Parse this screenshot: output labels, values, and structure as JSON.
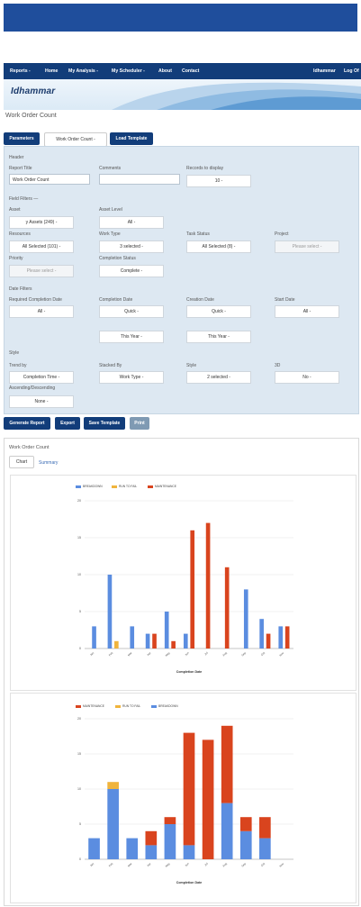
{
  "nav": {
    "items": [
      "Reports -",
      "Home",
      "My Analysis -",
      "My Scheduler -",
      "About",
      "Contact"
    ],
    "user": "ldhammar",
    "logout": "Log Of"
  },
  "brand": {
    "logo": "Idhammar"
  },
  "page_title": "Work Order Count",
  "tabs": {
    "parameters": "Parameters",
    "report": "Work Order Count -",
    "load": "Load Template"
  },
  "header_section": {
    "title": "Header",
    "report_title_label": "Report Title",
    "report_title_value": "Work Order Count",
    "comments_label": "Comments",
    "comments_value": "",
    "records_label": "Records to display",
    "records_value": "10 -"
  },
  "field_filters": {
    "title": "Field Filters —",
    "asset_label": "Asset",
    "asset_value": "y Assets (249) -",
    "asset_level_label": "Asset Level",
    "asset_level_value": "All -",
    "resources_label": "Resources",
    "resources_value": "All Selected (101) -",
    "work_type_label": "Work Type",
    "work_type_value": "3 selected -",
    "task_status_label": "Task Status",
    "task_status_value": "All Selected (8) -",
    "project_label": "Project",
    "project_value": "Please select -",
    "priority_label": "Priority",
    "priority_value": "Please select -",
    "completion_status_label": "Completion Status",
    "completion_status_value": "Complete -"
  },
  "date_filters": {
    "title": "Date Filters",
    "required_label": "Required Completion Date",
    "required_value": "All -",
    "completion_label": "Completion Date",
    "completion_value": "Quick -",
    "completion_range": "This Year -",
    "creation_label": "Creation Date",
    "creation_value": "Quick -",
    "creation_range": "This Year -",
    "start_label": "Start Date",
    "start_value": "All -"
  },
  "style_section": {
    "title": "Style",
    "trend_label": "Trend by",
    "trend_value": "Completion Time -",
    "stacked_label": "Stacked By",
    "stacked_value": "Work Type -",
    "style_label": "Style",
    "style_value": "2 selected -",
    "threed_label": "3D",
    "threed_value": "No -",
    "order_label": "Ascending/Descending",
    "order_value": "None -"
  },
  "actions": {
    "generate": "Generate Report",
    "export": "Export",
    "save": "Save Template",
    "print": "Print"
  },
  "report": {
    "title": "Work Order Count",
    "tab_chart": "Chart",
    "tab_summary": "Summary"
  },
  "colors": {
    "breakdown": "#5b8de0",
    "run_to_fail": "#f0b43c",
    "maintenance": "#d9441e",
    "nav": "#123d7a"
  },
  "chart_data": [
    {
      "type": "bar",
      "legend": [
        "BREAKDOWN",
        "RUN TO FAIL",
        "MAINTENANCE"
      ],
      "xlabel": "Completion Date",
      "ylim": [
        0,
        20
      ],
      "yticks": [
        0,
        5,
        10,
        15,
        20
      ],
      "categories": [
        "Jan",
        "Feb",
        "Mar",
        "Apr",
        "May",
        "Jun",
        "Jul",
        "Aug",
        "Sep",
        "Oct",
        "Nov"
      ],
      "series": [
        {
          "name": "BREAKDOWN",
          "values": [
            3,
            10,
            3,
            2,
            5,
            2,
            0,
            0,
            8,
            4,
            3
          ]
        },
        {
          "name": "RUN TO FAIL",
          "values": [
            0,
            1,
            0,
            0,
            0,
            0,
            0,
            0,
            0,
            0,
            0
          ]
        },
        {
          "name": "MAINTENANCE",
          "values": [
            0,
            0,
            0,
            2,
            1,
            16,
            17,
            11,
            0,
            2,
            3
          ]
        }
      ]
    },
    {
      "type": "bar",
      "stacked": true,
      "legend": [
        "MAINTENANCE",
        "RUN TO FAIL",
        "BREAKDOWN"
      ],
      "xlabel": "Completion Date",
      "ylim": [
        0,
        20
      ],
      "yticks": [
        0,
        5,
        10,
        15,
        20
      ],
      "categories": [
        "Jan",
        "Feb",
        "Mar",
        "Apr",
        "May",
        "Jun",
        "Jul",
        "Aug",
        "Sep",
        "Oct",
        "Nov"
      ],
      "series": [
        {
          "name": "BREAKDOWN",
          "values": [
            3,
            10,
            3,
            2,
            5,
            2,
            0,
            8,
            4,
            3,
            0
          ]
        },
        {
          "name": "RUN TO FAIL",
          "values": [
            0,
            1,
            0,
            0,
            0,
            0,
            0,
            0,
            0,
            0,
            0
          ]
        },
        {
          "name": "MAINTENANCE",
          "values": [
            0,
            0,
            0,
            2,
            1,
            16,
            17,
            11,
            2,
            3,
            0
          ]
        }
      ]
    }
  ]
}
